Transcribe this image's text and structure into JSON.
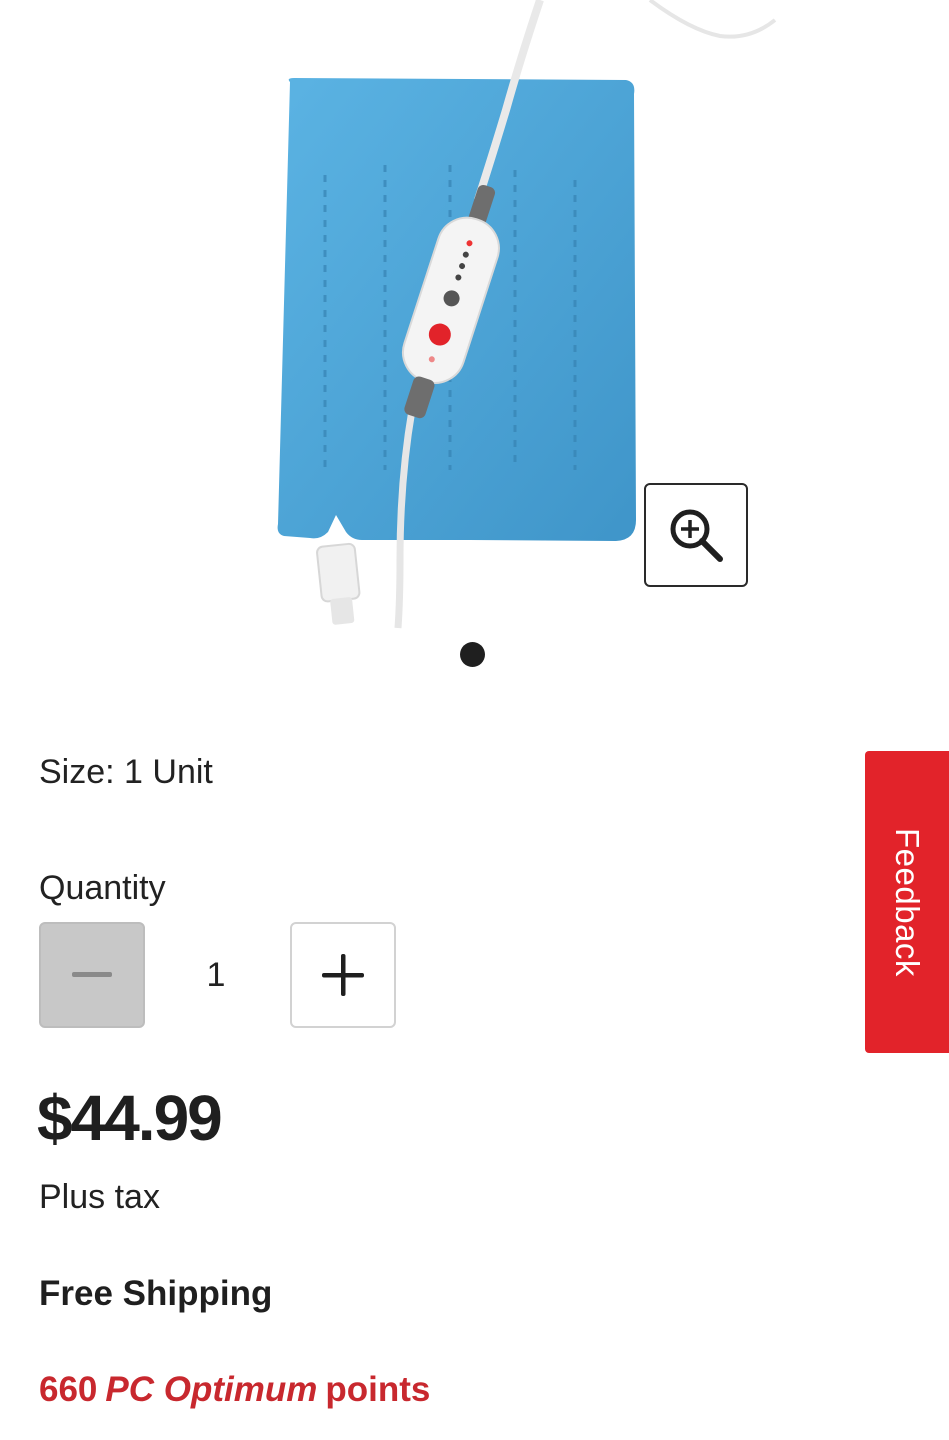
{
  "product": {
    "image_alt": "Blue heating pad with white hand controller",
    "carousel_count": 1,
    "carousel_active": 1
  },
  "icons": {
    "zoom": "zoom-in-icon",
    "minus": "minus-icon",
    "plus": "plus-icon"
  },
  "size": {
    "text": "Size: 1 Unit"
  },
  "quantity": {
    "label": "Quantity",
    "value": "1"
  },
  "price": {
    "amount": "$44.99",
    "tax_note": "Plus tax"
  },
  "shipping": {
    "text": "Free Shipping"
  },
  "points": {
    "count": "660",
    "brand": "PC Optimum",
    "suffix": "points"
  },
  "feedback": {
    "label": "Feedback"
  },
  "colors": {
    "accent_red": "#e2232a",
    "points_red": "#c8282e",
    "pad_blue": "#4aa3d6",
    "disabled_grey": "#c8c8c8"
  }
}
